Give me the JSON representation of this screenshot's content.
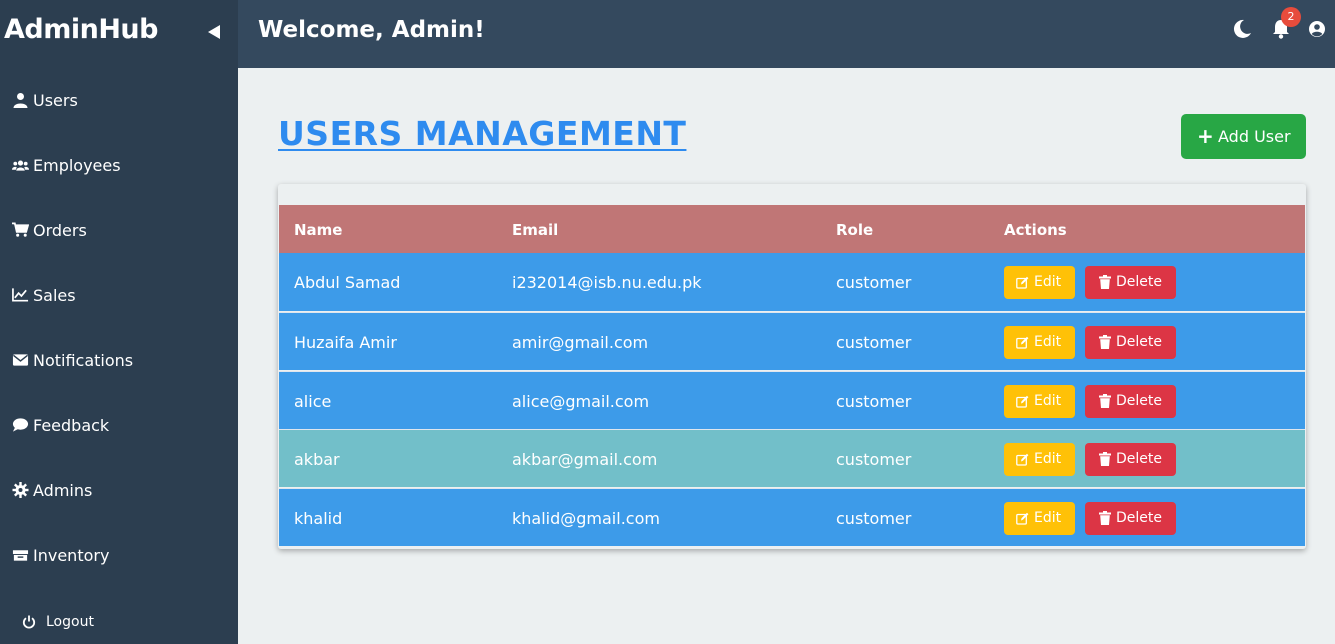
{
  "app": {
    "brand": "AdminHub",
    "welcome": "Welcome, Admin!"
  },
  "header": {
    "notification_count": "2"
  },
  "sidebar": {
    "items": [
      {
        "label": "Users",
        "icon": "user-icon"
      },
      {
        "label": "Employees",
        "icon": "users-icon"
      },
      {
        "label": "Orders",
        "icon": "cart-icon"
      },
      {
        "label": "Sales",
        "icon": "chart-line-icon"
      },
      {
        "label": "Notifications",
        "icon": "envelope-icon"
      },
      {
        "label": "Feedback",
        "icon": "comment-icon"
      },
      {
        "label": "Admins",
        "icon": "gear-icon"
      },
      {
        "label": "Inventory",
        "icon": "box-icon"
      }
    ],
    "logout": "Logout"
  },
  "main": {
    "title": "USERS MANAGEMENT",
    "add_button": "Add User",
    "table": {
      "headers": [
        "Name",
        "Email",
        "Role",
        "Actions"
      ],
      "rows": [
        {
          "name": "Abdul Samad",
          "email": "i232014@isb.nu.edu.pk",
          "role": "customer"
        },
        {
          "name": "Huzaifa Amir",
          "email": "amir@gmail.com",
          "role": "customer"
        },
        {
          "name": "alice",
          "email": "alice@gmail.com",
          "role": "customer"
        },
        {
          "name": "akbar",
          "email": "akbar@gmail.com",
          "role": "customer"
        },
        {
          "name": "khalid",
          "email": "khalid@gmail.com",
          "role": "customer"
        }
      ],
      "edit_label": "Edit",
      "delete_label": "Delete"
    }
  },
  "colors": {
    "row": "#3d9be9",
    "row_hover": "#72bfc9",
    "header": "#c07676",
    "accent": "#2e8bef",
    "success": "#28a745",
    "warning": "#ffc107",
    "danger": "#dc3545"
  }
}
